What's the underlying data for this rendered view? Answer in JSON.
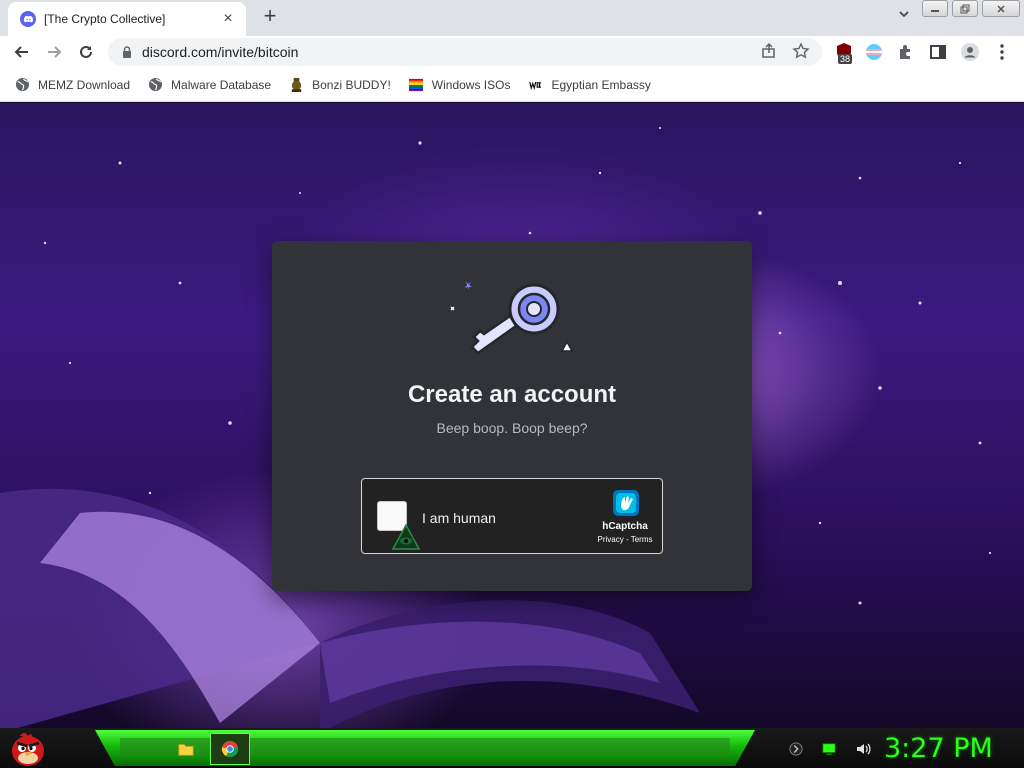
{
  "browser": {
    "tab": {
      "title": "[The Crypto Collective]",
      "favicon": "discord-icon"
    },
    "address": {
      "url": "discord.com/invite/bitcoin"
    },
    "extensions": {
      "badge_count": "38"
    },
    "bookmarks": [
      {
        "label": "MEMZ Download",
        "icon": "globe-icon"
      },
      {
        "label": "Malware Database",
        "icon": "globe-icon"
      },
      {
        "label": "Bonzi BUDDY!",
        "icon": "bonzi-icon"
      },
      {
        "label": "Windows ISOs",
        "icon": "rainbow-flag-icon"
      },
      {
        "label": "Egyptian Embassy",
        "icon": "wix-icon"
      }
    ]
  },
  "modal": {
    "title": "Create an account",
    "subtitle": "Beep boop. Boop beep?",
    "captcha": {
      "label": "I am human",
      "brand": "hCaptcha",
      "privacy": "Privacy",
      "terms": "Terms"
    }
  },
  "taskbar": {
    "clock": "3:27 PM",
    "apps": [
      "folder-icon",
      "chrome-icon"
    ]
  },
  "colors": {
    "discord_blurple": "#5865f2",
    "modal_bg": "#313338",
    "clock_green": "#2cff1a"
  }
}
